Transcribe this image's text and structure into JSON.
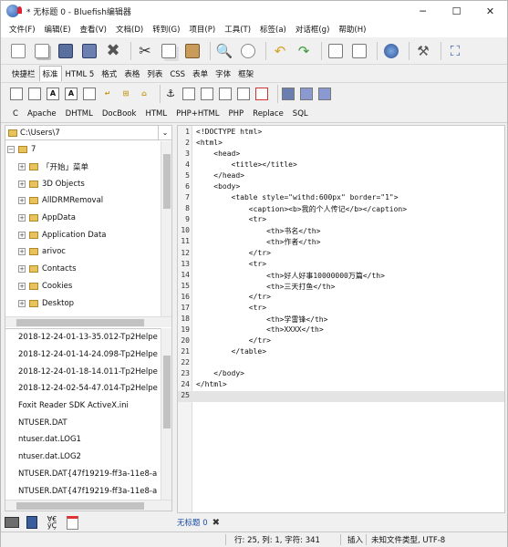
{
  "window": {
    "title": "* 无标题 0 - Bluefish编辑器",
    "minimize_glyph": "─",
    "maximize_glyph": "☐",
    "close_glyph": "✕"
  },
  "menu": [
    "文件(F)",
    "编辑(E)",
    "查看(V)",
    "文档(D)",
    "转到(G)",
    "项目(P)",
    "工具(T)",
    "标签(a)",
    "对话框(g)",
    "帮助(H)"
  ],
  "toolbar_main_icons": [
    "new-file-icon",
    "open-file-icon",
    "save-icon",
    "save-as-icon",
    "close-file-icon",
    "cut-icon",
    "copy-icon",
    "paste-icon",
    "find-icon",
    "replace-icon",
    "undo-icon",
    "redo-icon",
    "indent-icon",
    "unindent-icon",
    "preview-icon",
    "settings-icon",
    "fullscreen-icon"
  ],
  "tabs": [
    "快捷栏",
    "标准",
    "HTML 5",
    "格式",
    "表格",
    "列表",
    "CSS",
    "表单",
    "字体",
    "框架"
  ],
  "active_tab": "标准",
  "toolbar_html_icons": [
    "quickstart-icon",
    "body-icon",
    "bold-icon",
    "italic-icon",
    "paragraph-icon",
    "break-icon",
    "nbsp-icon",
    "comment-icon",
    "anchor-icon",
    "div-icon",
    "list-icon",
    "table-icon",
    "email-icon",
    "image-icon",
    "thumbnail-icon",
    "multi-thumbnail-icon",
    "hr-icon"
  ],
  "toolbar3": [
    "C",
    "Apache",
    "DHTML",
    "DocBook",
    "HTML",
    "PHP+HTML",
    "PHP",
    "Replace",
    "SQL"
  ],
  "sidebar": {
    "path": "C:\\Users\\7",
    "tree_root": "7",
    "tree_items": [
      "「开始」菜单",
      "3D Objects",
      "AllDRMRemoval",
      "AppData",
      "Application Data",
      "arivoc",
      "Contacts",
      "Cookies",
      "Desktop"
    ],
    "files": [
      "2018-12-24-01-13-35.012-Tp2Helpe",
      "2018-12-24-01-14-24.098-Tp2Helpe",
      "2018-12-24-01-18-14.011-Tp2Helpe",
      "2018-12-24-02-54-47.014-Tp2Helpe",
      "Foxit Reader SDK ActiveX.ini",
      "NTUSER.DAT",
      "ntuser.dat.LOG1",
      "ntuser.dat.LOG2",
      "NTUSER.DAT{47f19219-ff3a-11e8-a",
      "NTUSER.DAT{47f19219-ff3a-11e8-a"
    ]
  },
  "editor": {
    "lines": [
      {
        "n": "1",
        "t": "<!DOCTYPE html>"
      },
      {
        "n": "2",
        "t": "<html>"
      },
      {
        "n": "3",
        "t": "    <head>"
      },
      {
        "n": "4",
        "t": "        <title></title>"
      },
      {
        "n": "5",
        "t": "    </head>"
      },
      {
        "n": "6",
        "t": "    <body>"
      },
      {
        "n": "7",
        "t": "        <table style=\"withd:600px\" border=\"1\">"
      },
      {
        "n": "8",
        "t": "            <caption><b>我的个人传记</b></caption>"
      },
      {
        "n": "9",
        "t": "            <tr>"
      },
      {
        "n": "10",
        "t": "                <th>书名</th>"
      },
      {
        "n": "11",
        "t": "                <th>作者</th>"
      },
      {
        "n": "12",
        "t": "            </tr>"
      },
      {
        "n": "13",
        "t": "            <tr>"
      },
      {
        "n": "14",
        "t": "                <th>好人好事10000000万篇</th>"
      },
      {
        "n": "15",
        "t": "                <th>三天打鱼</th>"
      },
      {
        "n": "16",
        "t": "            </tr>"
      },
      {
        "n": "17",
        "t": "            <tr>"
      },
      {
        "n": "18",
        "t": "                <th>学雷锋</th>"
      },
      {
        "n": "19",
        "t": "                <th>XXXX</th>"
      },
      {
        "n": "20",
        "t": "            </tr>"
      },
      {
        "n": "21",
        "t": "        </table>"
      },
      {
        "n": "22",
        "t": ""
      },
      {
        "n": "23",
        "t": "    </body>"
      },
      {
        "n": "24",
        "t": "</html>"
      },
      {
        "n": "25",
        "t": ""
      }
    ],
    "current_line": 25
  },
  "doc_tab": {
    "label": "无标题 0",
    "close": "✖"
  },
  "status": {
    "position": "行: 25, 列: 1, 字符: 341",
    "mode": "插入",
    "encoding": "未知文件类型, UTF-8"
  }
}
